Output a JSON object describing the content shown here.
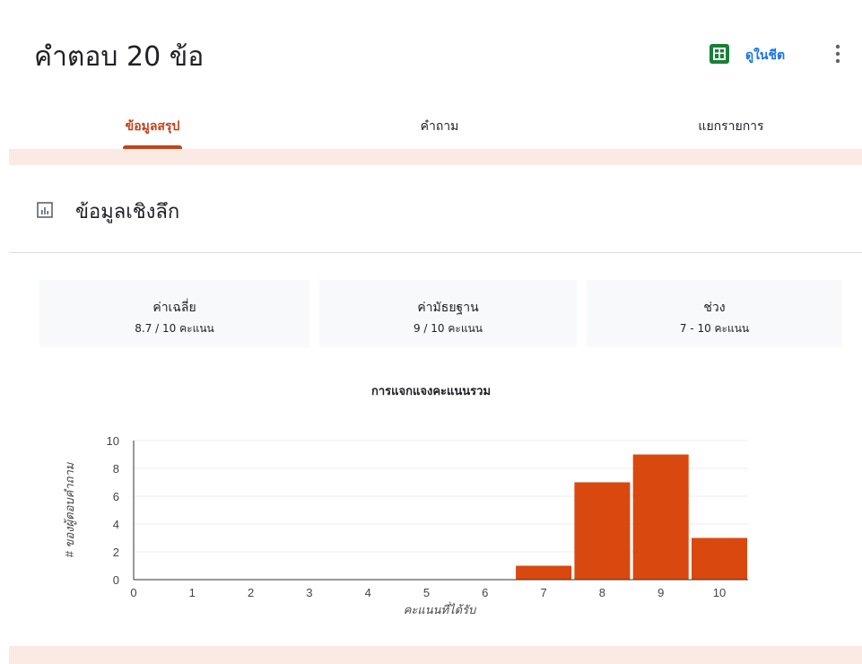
{
  "header": {
    "title": "คำตอบ 20 ข้อ",
    "view_in_sheet": "ดูในชีต",
    "sheet_icon": "google-sheets-icon",
    "more_icon": "more-vert-icon",
    "accent": "#c5411b"
  },
  "tabs": [
    {
      "label": "ข้อมูลสรุป",
      "active": true
    },
    {
      "label": "คำถาม",
      "active": false
    },
    {
      "label": "แยกรายการ",
      "active": false
    }
  ],
  "insights": {
    "icon": "bar-chart-icon",
    "title": "ข้อมูลเชิงลึก",
    "stats": [
      {
        "label": "ค่าเฉลี่ย",
        "value": "8.7 / 10 คะแนน"
      },
      {
        "label": "ค่ามัธยฐาน",
        "value": "9 / 10 คะแนน"
      },
      {
        "label": "ช่วง",
        "value": "7 - 10 คะแนน"
      }
    ]
  },
  "chart_data": {
    "type": "bar",
    "title": "การแจกแจงคะแนนรวม",
    "xlabel": "คะแนนที่ได้รับ",
    "ylabel": "# ของผู้ตอบคำถาม",
    "categories": [
      "0",
      "1",
      "2",
      "3",
      "4",
      "5",
      "6",
      "7",
      "8",
      "9",
      "10"
    ],
    "values": [
      0,
      0,
      0,
      0,
      0,
      0,
      0,
      1,
      7,
      9,
      3
    ],
    "ylim": [
      0,
      10
    ],
    "yticks": [
      0,
      2,
      4,
      6,
      8,
      10
    ],
    "bar_color": "#d9480f"
  }
}
